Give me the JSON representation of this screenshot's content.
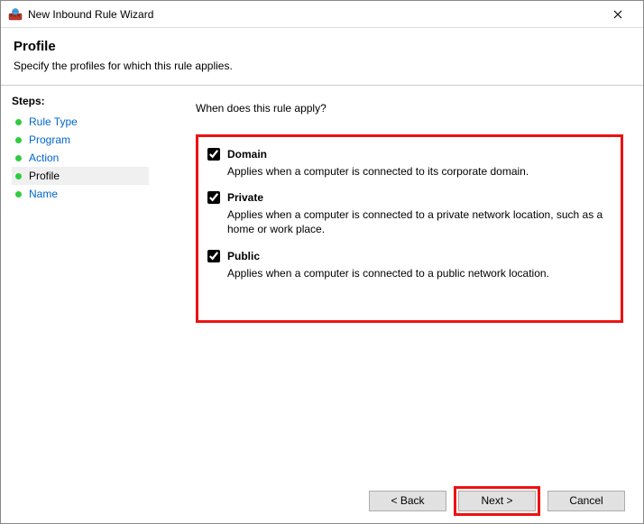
{
  "window": {
    "title": "New Inbound Rule Wizard"
  },
  "header": {
    "title": "Profile",
    "subtitle": "Specify the profiles for which this rule applies."
  },
  "sidebar": {
    "title": "Steps:",
    "items": [
      {
        "label": "Rule Type"
      },
      {
        "label": "Program"
      },
      {
        "label": "Action"
      },
      {
        "label": "Profile"
      },
      {
        "label": "Name"
      }
    ],
    "current_index": 3
  },
  "content": {
    "question": "When does this rule apply?",
    "options": [
      {
        "key": "domain",
        "label": "Domain",
        "checked": true,
        "desc": "Applies when a computer is connected to its corporate domain."
      },
      {
        "key": "private",
        "label": "Private",
        "checked": true,
        "desc": "Applies when a computer is connected to a private network location, such as a home or work place."
      },
      {
        "key": "public",
        "label": "Public",
        "checked": true,
        "desc": "Applies when a computer is connected to a public network location."
      }
    ]
  },
  "footer": {
    "back": "< Back",
    "next": "Next >",
    "cancel": "Cancel"
  }
}
